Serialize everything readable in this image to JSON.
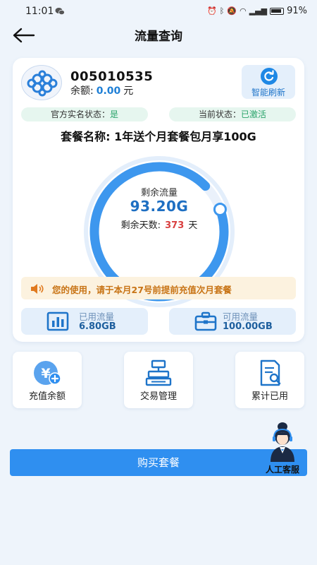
{
  "status_bar": {
    "time": "11:01",
    "battery": "91%"
  },
  "header": {
    "title": "流量查询"
  },
  "account": {
    "phone_number": "005010535",
    "balance_label": "余额:",
    "balance_value": "0.00",
    "balance_unit": "元",
    "refresh_label": "智能刷新"
  },
  "status": {
    "realname_label": "官方实名状态：",
    "realname_value": "是",
    "current_label": "当前状态：",
    "current_value": "已激活"
  },
  "package": {
    "name": "套餐名称: 1年送个月套餐包月享100G"
  },
  "gauge": {
    "remaining_label": "剩余流量",
    "remaining_value": "93.20G",
    "days_label": "剩余天数:",
    "days_value": "373",
    "days_unit": "天",
    "remaining_fraction": 0.932
  },
  "notice": {
    "text": "您的使用，请于本月27号前提前充值次月套餐"
  },
  "stats": {
    "used_label": "已用流量",
    "used_value": "6.80GB",
    "available_label": "可用流量",
    "available_value": "100.00GB"
  },
  "actions": {
    "recharge": "充值余额",
    "transactions": "交易管理",
    "cumulative": "累计已用"
  },
  "buy_button": "购买套餐",
  "service_label": "人工客服",
  "colors": {
    "accent": "#2f8ff0",
    "success": "#29a36a",
    "warning": "#c87416",
    "danger": "#d94040"
  }
}
